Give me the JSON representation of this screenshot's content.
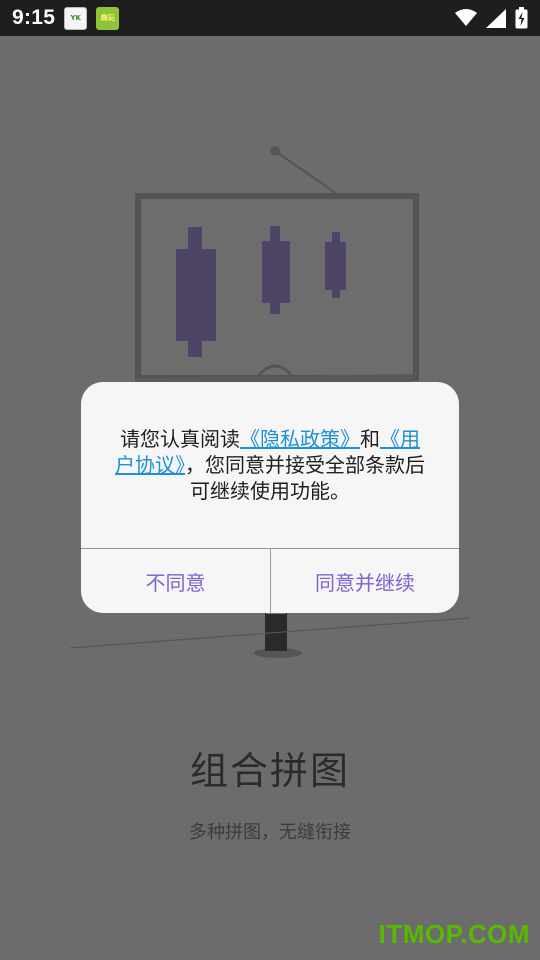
{
  "status_bar": {
    "time": "9:15",
    "notification_icons": [
      "yk-app-icon",
      "game-app-icon"
    ],
    "notif_a_text": "YK",
    "notif_b_text": "趣玩",
    "right_icons": [
      "wifi-icon",
      "signal-icon",
      "battery-charging-icon"
    ]
  },
  "onboarding": {
    "title": "组合拼图",
    "subtitle": "多种拼图，无缝衔接"
  },
  "dialog": {
    "message_part1": "请您认真阅读",
    "privacy_link": "《隐私政策》",
    "message_part2": "和",
    "agreement_link": "《用户协议》",
    "message_part3": "，您同意并接受全部条款后可继续使用功能。",
    "disagree_label": "不同意",
    "agree_label": "同意并继续"
  },
  "watermark": "ITMOP.COM",
  "colors": {
    "overlay_background": "#6c6c6c",
    "link": "#1f8fd6",
    "dialog_button_text": "#7f63cf",
    "watermark": "#59b800"
  }
}
